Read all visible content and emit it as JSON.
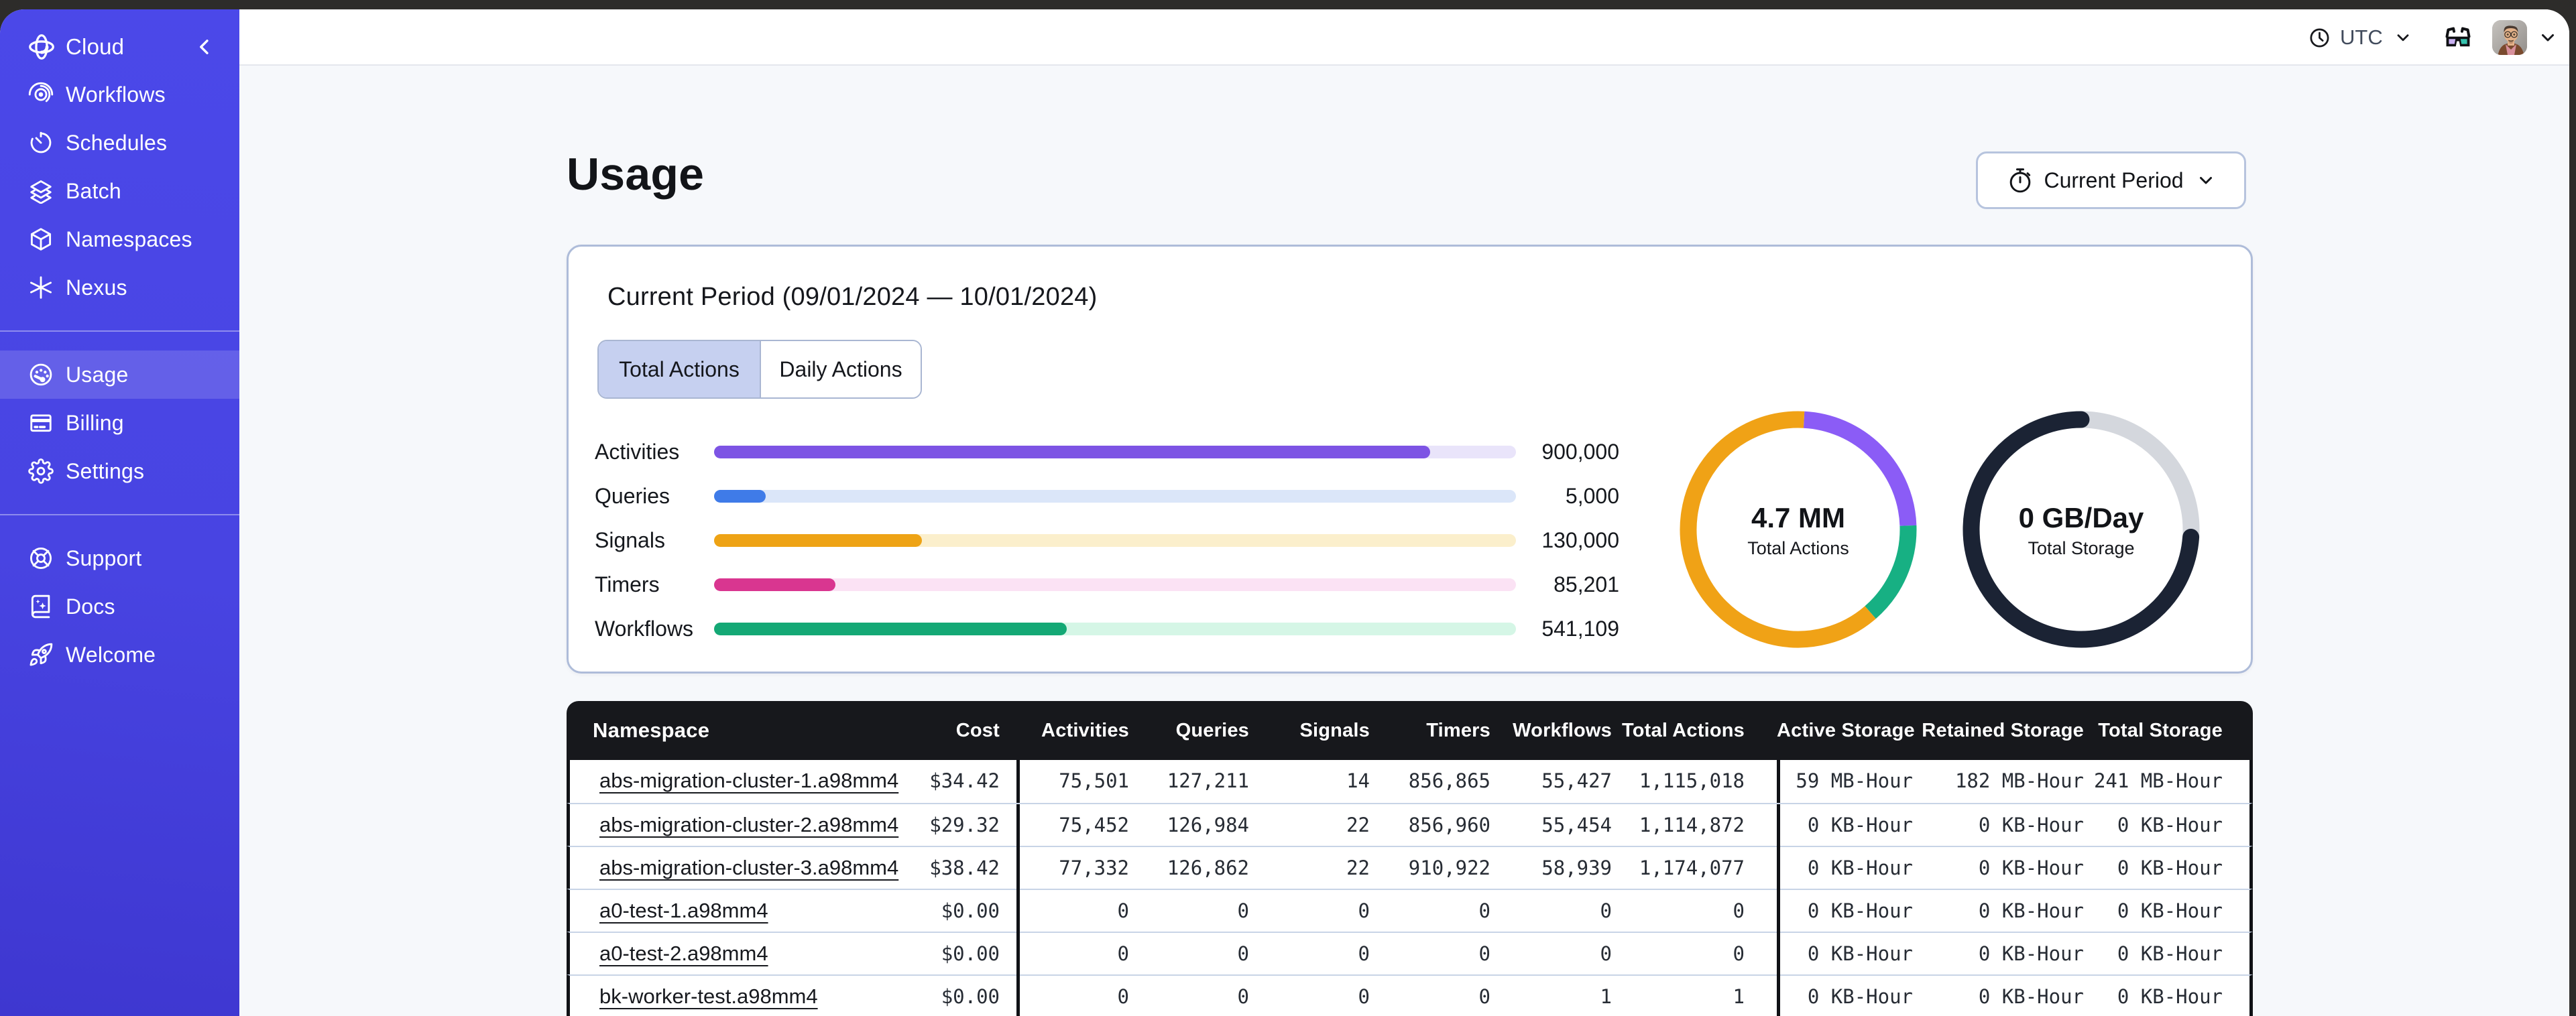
{
  "topbar": {
    "timezone": "UTC"
  },
  "sidebar": {
    "brand": "Cloud",
    "groups": [
      {
        "items": [
          {
            "icon": "workflows",
            "label": "Workflows"
          },
          {
            "icon": "schedules",
            "label": "Schedules"
          },
          {
            "icon": "batch",
            "label": "Batch"
          },
          {
            "icon": "namespaces",
            "label": "Namespaces"
          },
          {
            "icon": "nexus",
            "label": "Nexus"
          }
        ]
      },
      {
        "items": [
          {
            "icon": "usage",
            "label": "Usage",
            "active": true
          },
          {
            "icon": "billing",
            "label": "Billing"
          },
          {
            "icon": "settings",
            "label": "Settings"
          }
        ]
      },
      {
        "items": [
          {
            "icon": "support",
            "label": "Support"
          },
          {
            "icon": "docs",
            "label": "Docs"
          },
          {
            "icon": "welcome",
            "label": "Welcome"
          }
        ]
      }
    ]
  },
  "page": {
    "title": "Usage",
    "period_button_label": "Current Period"
  },
  "usage_card": {
    "title": "Current Period (09/01/2024 — 10/01/2024)",
    "tabs": [
      {
        "label": "Total Actions",
        "active": true
      },
      {
        "label": "Daily Actions",
        "active": false
      }
    ]
  },
  "chart_data": [
    {
      "type": "bar",
      "title": "Total Actions by action type",
      "categories": [
        "Activities",
        "Queries",
        "Signals",
        "Timers",
        "Workflows"
      ],
      "values": [
        900000,
        5000,
        130000,
        85201,
        541109
      ],
      "value_labels": [
        "900,000",
        "5,000",
        "130,000",
        "85,201",
        "541,109"
      ],
      "fill_pct": [
        89.3,
        6.4,
        25.9,
        15.1,
        44.0
      ],
      "colors": [
        "#7d54e4",
        "#3f7be8",
        "#eea315",
        "#d93690",
        "#14a875"
      ],
      "track_colors": [
        "#e9e4fa",
        "#dbe6f9",
        "#fbefcc",
        "#fbe2f4",
        "#d5f6e6"
      ],
      "legend": "none",
      "grid": false
    },
    {
      "type": "donut",
      "center_value": "4.7 MM",
      "center_label": "Total Actions",
      "segments": [
        {
          "name": "purple",
          "color": "#8b5cf6",
          "pct": 23.6,
          "from": 3,
          "to": 88
        },
        {
          "name": "green",
          "color": "#17b083",
          "pct": 14.2,
          "from": 88,
          "to": 139
        },
        {
          "name": "orange",
          "color": "#f0a216",
          "pct": 62.2,
          "from": 139,
          "to": 363
        }
      ]
    },
    {
      "type": "donut",
      "center_value": "0 GB/Day",
      "center_label": "Total Storage",
      "segments": [
        {
          "name": "track",
          "color": "#d4d7dd",
          "pct": 24,
          "full": true
        },
        {
          "name": "used",
          "color": "#1b2334",
          "pct": 76,
          "from": 94,
          "to": 360,
          "rounded": true
        }
      ]
    }
  ],
  "table": {
    "columns": [
      "Namespace",
      "Cost",
      "Activities",
      "Queries",
      "Signals",
      "Timers",
      "Workflows",
      "Total Actions",
      "Active Storage",
      "Retained Storage",
      "Total Storage"
    ],
    "rows": [
      [
        "abs-migration-cluster-1.a98mm4",
        "$34.42",
        "75,501",
        "127,211",
        "14",
        "856,865",
        "55,427",
        "1,115,018",
        "59 MB-Hour",
        "182 MB-Hour",
        "241 MB-Hour"
      ],
      [
        "abs-migration-cluster-2.a98mm4",
        "$29.32",
        "75,452",
        "126,984",
        "22",
        "856,960",
        "55,454",
        "1,114,872",
        "0 KB-Hour",
        "0 KB-Hour",
        "0 KB-Hour"
      ],
      [
        "abs-migration-cluster-3.a98mm4",
        "$38.42",
        "77,332",
        "126,862",
        "22",
        "910,922",
        "58,939",
        "1,174,077",
        "0 KB-Hour",
        "0 KB-Hour",
        "0 KB-Hour"
      ],
      [
        "a0-test-1.a98mm4",
        "$0.00",
        "0",
        "0",
        "0",
        "0",
        "0",
        "0",
        "0 KB-Hour",
        "0 KB-Hour",
        "0 KB-Hour"
      ],
      [
        "a0-test-2.a98mm4",
        "$0.00",
        "0",
        "0",
        "0",
        "0",
        "0",
        "0",
        "0 KB-Hour",
        "0 KB-Hour",
        "0 KB-Hour"
      ],
      [
        "bk-worker-test.a98mm4",
        "$0.00",
        "0",
        "0",
        "0",
        "0",
        "1",
        "1",
        "0 KB-Hour",
        "0 KB-Hour",
        "0 KB-Hour"
      ]
    ]
  }
}
